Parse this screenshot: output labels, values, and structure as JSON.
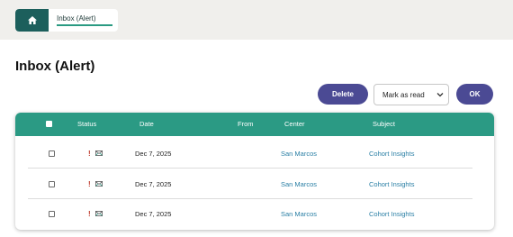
{
  "breadcrumb": {
    "home_icon": "home-icon",
    "current": "Inbox (Alert)"
  },
  "page": {
    "title": "Inbox (Alert)"
  },
  "toolbar": {
    "delete_label": "Delete",
    "action_select_value": "Mark as read",
    "ok_label": "OK"
  },
  "table": {
    "headers": {
      "status": "Status",
      "date": "Date",
      "from": "From",
      "center": "Center",
      "subject": "Subject"
    },
    "rows": [
      {
        "priority_mark": "!",
        "date": "Dec 7, 2025",
        "from": "",
        "center": "San Marcos",
        "subject": "Cohort Insights"
      },
      {
        "priority_mark": "!",
        "date": "Dec 7, 2025",
        "from": "",
        "center": "San Marcos",
        "subject": "Cohort Insights"
      },
      {
        "priority_mark": "!",
        "date": "Dec 7, 2025",
        "from": "",
        "center": "San Marcos",
        "subject": "Cohort Insights"
      }
    ]
  },
  "colors": {
    "header_teal": "#2b9a84",
    "home_button": "#1c5f5c",
    "primary_button": "#4b4a94",
    "link": "#2a7fa5",
    "priority": "#c0392b"
  }
}
